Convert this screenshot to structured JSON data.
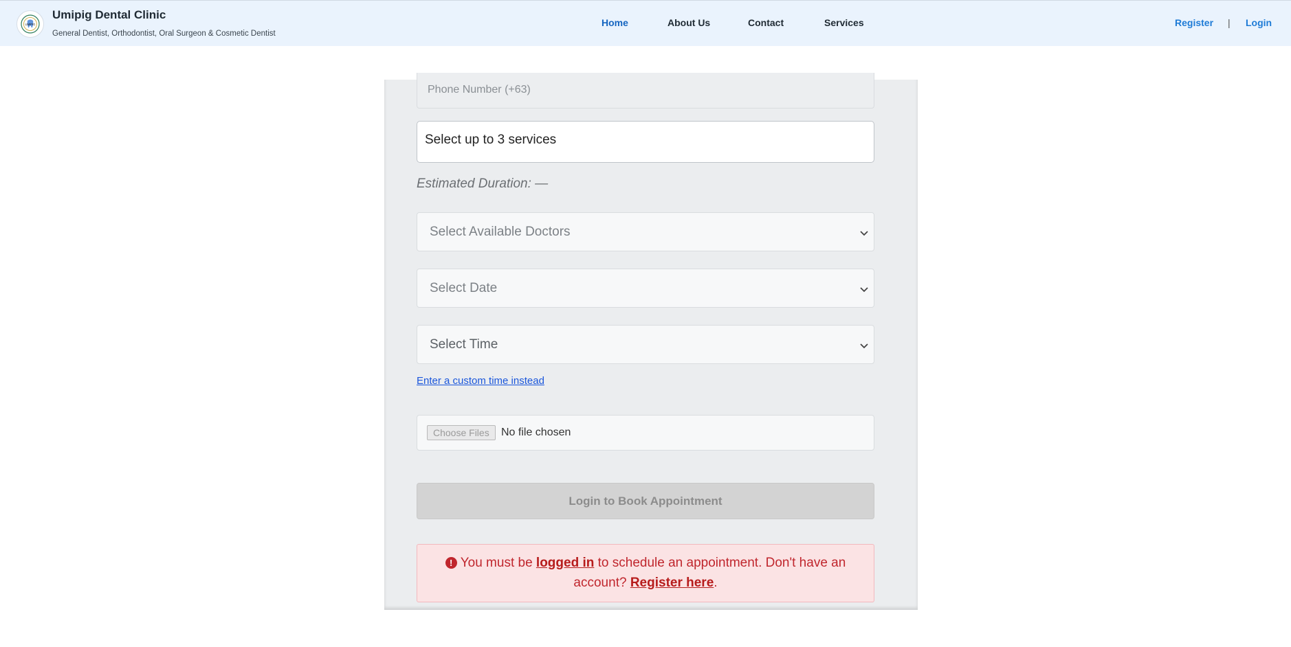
{
  "header": {
    "brand_title": "Umipig Dental Clinic",
    "brand_subtitle": "General Dentist, Orthodontist, Oral Surgeon & Cosmetic Dentist",
    "logo_text": "UMIPIG",
    "nav": {
      "home": "Home",
      "about": "About Us",
      "contact": "Contact",
      "services": "Services"
    },
    "auth": {
      "register": "Register",
      "separator": "|",
      "login": "Login"
    }
  },
  "form": {
    "phone_placeholder": "Phone Number (+63)",
    "services_placeholder": "Select up to 3 services",
    "estimated_duration": "Estimated Duration: —",
    "doctor_select": "Select Available Doctors",
    "date_select": "Select Date",
    "time_select": "Select Time",
    "custom_time_link": "Enter a custom time instead",
    "file_button": "Choose Files",
    "file_status": "No file chosen",
    "submit_button": "Login to Book Appointment"
  },
  "alert": {
    "icon": "exclamation-circle-icon",
    "part1": "You must be ",
    "login_link": "logged in",
    "part2": " to schedule an appointment. Don't have an account? ",
    "register_link": "Register here",
    "part3": "."
  },
  "colors": {
    "header_bg": "#eaf3fd",
    "accent_blue": "#1565c0",
    "alert_red": "#c0262d",
    "alert_bg": "#fbe3e4"
  }
}
